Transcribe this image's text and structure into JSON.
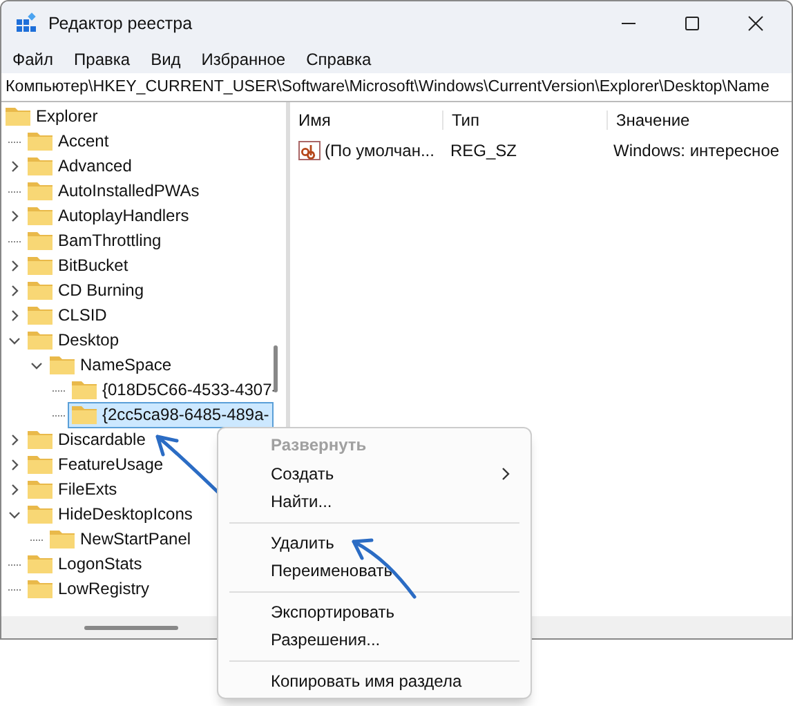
{
  "window": {
    "title": "Редактор реестра"
  },
  "menu": [
    "Файл",
    "Правка",
    "Вид",
    "Избранное",
    "Справка"
  ],
  "address": "Компьютер\\HKEY_CURRENT_USER\\Software\\Microsoft\\Windows\\CurrentVersion\\Explorer\\Desktop\\Name",
  "tree": [
    {
      "label": "Explorer",
      "selected": false,
      "children": [
        {
          "label": "Accent",
          "expandable": false,
          "selected": false
        },
        {
          "label": "Advanced",
          "expandable": true,
          "expanded": false,
          "selected": false
        },
        {
          "label": "AutoInstalledPWAs",
          "expandable": false,
          "selected": false
        },
        {
          "label": "AutoplayHandlers",
          "expandable": true,
          "expanded": false,
          "selected": false
        },
        {
          "label": "BamThrottling",
          "expandable": false,
          "selected": false
        },
        {
          "label": "BitBucket",
          "expandable": true,
          "expanded": false,
          "selected": false
        },
        {
          "label": "CD Burning",
          "expandable": true,
          "expanded": false,
          "selected": false
        },
        {
          "label": "CLSID",
          "expandable": true,
          "expanded": false,
          "selected": false
        },
        {
          "label": "Desktop",
          "expandable": true,
          "expanded": true,
          "selected": false,
          "children": [
            {
              "label": "NameSpace",
              "expandable": true,
              "expanded": true,
              "selected": false,
              "children": [
                {
                  "label": "{018D5C66-4533-4307-",
                  "expandable": false,
                  "selected": false
                },
                {
                  "label": "{2cc5ca98-6485-489a-",
                  "expandable": false,
                  "selected": true
                }
              ]
            }
          ]
        },
        {
          "label": "Discardable",
          "expandable": true,
          "expanded": false,
          "selected": false
        },
        {
          "label": "FeatureUsage",
          "expandable": true,
          "expanded": false,
          "selected": false
        },
        {
          "label": "FileExts",
          "expandable": true,
          "expanded": false,
          "selected": false
        },
        {
          "label": "HideDesktopIcons",
          "expandable": true,
          "expanded": true,
          "selected": false,
          "children": [
            {
              "label": "NewStartPanel",
              "expandable": false,
              "selected": false
            }
          ]
        },
        {
          "label": "LogonStats",
          "expandable": false,
          "selected": false
        },
        {
          "label": "LowRegistry",
          "expandable": false,
          "selected": false
        }
      ]
    }
  ],
  "values_table": {
    "columns": [
      "Имя",
      "Тип",
      "Значение"
    ],
    "rows": [
      {
        "name": "(По умолчан...",
        "type": "REG_SZ",
        "value": "Windows: интересное"
      }
    ]
  },
  "context_menu": {
    "items": [
      {
        "kind": "item",
        "label": "Развернуть",
        "disabled": true,
        "submenu": false
      },
      {
        "kind": "item",
        "label": "Создать",
        "disabled": false,
        "submenu": true
      },
      {
        "kind": "item",
        "label": "Найти...",
        "disabled": false,
        "submenu": false
      },
      {
        "kind": "separator"
      },
      {
        "kind": "item",
        "label": "Удалить",
        "disabled": false,
        "submenu": false
      },
      {
        "kind": "item",
        "label": "Переименовать",
        "disabled": false,
        "submenu": false
      },
      {
        "kind": "separator"
      },
      {
        "kind": "item",
        "label": "Экспортировать",
        "disabled": false,
        "submenu": false
      },
      {
        "kind": "item",
        "label": "Разрешения...",
        "disabled": false,
        "submenu": false
      },
      {
        "kind": "separator"
      },
      {
        "kind": "item",
        "label": "Копировать имя раздела",
        "disabled": false,
        "submenu": false
      }
    ]
  }
}
